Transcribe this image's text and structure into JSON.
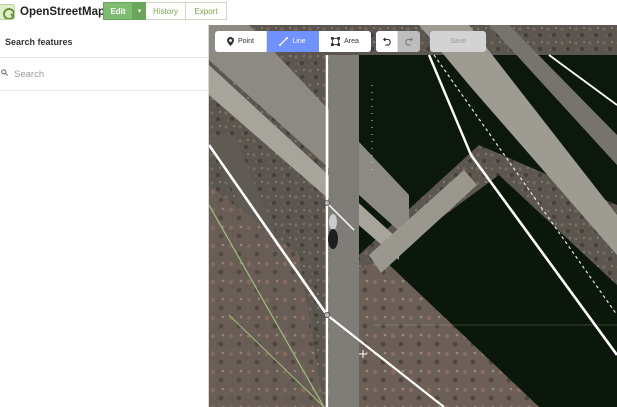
{
  "header": {
    "app_name": "OpenStreetMap",
    "nav": {
      "edit": "Edit",
      "caret": "▾",
      "history": "History",
      "export": "Export"
    }
  },
  "sidebar": {
    "title": "Search features",
    "search_placeholder": "Search"
  },
  "toolbar": {
    "point": "Point",
    "line": "Line",
    "area": "Area",
    "save": "Save"
  },
  "colors": {
    "brand_green": "#7ebc6f",
    "tool_active": "#7092ff",
    "road_white": "#ffffff",
    "water_dark": "#0e1a0e"
  },
  "icons": {
    "logo": "osm-logo-icon",
    "search": "search-icon",
    "point": "map-pin-icon",
    "line": "line-icon",
    "area": "area-icon",
    "undo": "undo-icon",
    "redo": "redo-icon",
    "cursor": "crosshair-icon"
  }
}
